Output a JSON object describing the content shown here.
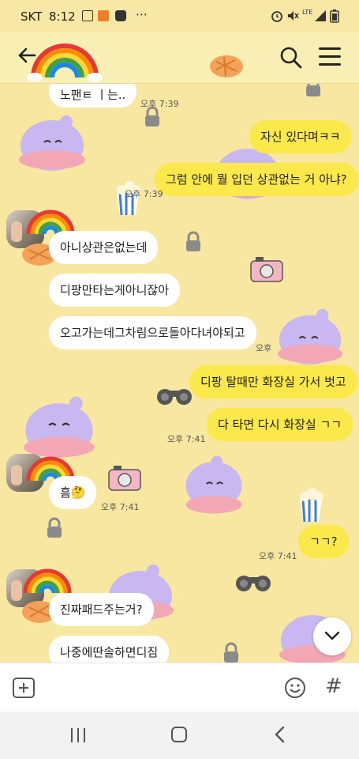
{
  "status_bar": {
    "carrier": "SKT",
    "time": "8:12",
    "dots": "⋯",
    "network": "LTE"
  },
  "header": {
    "back_icon": "arrow-left-icon",
    "search_icon": "search-icon",
    "menu_icon": "menu-icon"
  },
  "messages": [
    {
      "direction": "in",
      "text": "노팬ㅌ ㅣ는..",
      "time": "오후 7:39"
    },
    {
      "direction": "out",
      "text": "자신 있다며ㅋㅋ"
    },
    {
      "direction": "out",
      "text": "그럼 안에 뭘 입던 상관없는 거 아냐?",
      "time": "오후 7:39"
    },
    {
      "direction": "in",
      "text": "아니상관은없는데"
    },
    {
      "direction": "in",
      "text": "디팡만타는게아니잖아"
    },
    {
      "direction": "in",
      "text": "오고가는데그차림으로돌아다녀야되고",
      "time": "오후"
    },
    {
      "direction": "out",
      "text": "디팡 탈때만 화장실 가서 벗고"
    },
    {
      "direction": "out",
      "text": "다 타면 다시 화장실 ㄱㄱ",
      "time": "오후 7:41"
    },
    {
      "direction": "in",
      "text": "흠🤔",
      "time": "오후 7:41"
    },
    {
      "direction": "out",
      "text": "ㄱㄱ?",
      "time": "오후 7:41"
    },
    {
      "direction": "in",
      "text": "진짜패드주는거?"
    },
    {
      "direction": "in",
      "text": "나중에딴솔하면디짐"
    }
  ],
  "input_bar": {
    "plus_icon": "plus-icon",
    "emoji_icon": "emoji-icon",
    "hash_label": "#"
  },
  "colors": {
    "chat_bg": "#f8e7a1",
    "outgoing_bubble": "#fbe84a",
    "incoming_bubble": "#ffffff"
  }
}
